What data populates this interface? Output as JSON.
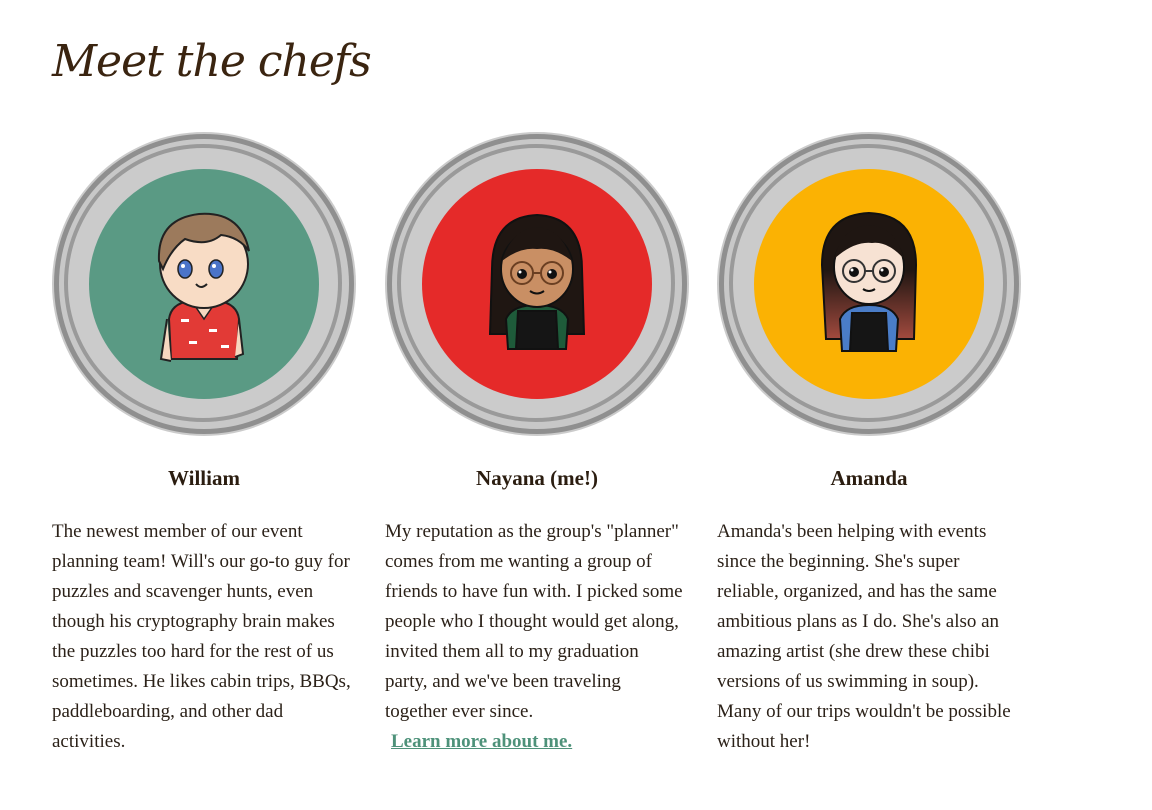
{
  "page": {
    "title": "Meet the chefs"
  },
  "chefs": [
    {
      "name": "William",
      "bio": "The newest member of our event planning team! Will's our go-to guy for puzzles and scavenger hunts, even though his cryptography brain makes the puzzles too hard for the rest of us sometimes. He likes cabin trips, BBQs, paddleboarding, and other dad activities.",
      "soup_color": "#5a9a84",
      "avatar_icon": "chibi-william-icon"
    },
    {
      "name": "Nayana (me!)",
      "bio": "My reputation as the group's \"planner\" comes from me wanting a group of friends to have fun with. I picked some people who I thought would get along, invited them all to my graduation party, and we've been traveling together ever since.",
      "link_label": "Learn more about me.",
      "soup_color": "#e52a29",
      "avatar_icon": "chibi-nayana-icon"
    },
    {
      "name": "Amanda",
      "bio": "Amanda's been helping with events since the beginning. She's super reliable, organized, and has the same ambitious plans as I do. She's also an amazing artist (she drew these chibi versions of us swimming in soup). Many of our trips wouldn't be possible without her!",
      "soup_color": "#fbb203",
      "avatar_icon": "chibi-amanda-icon"
    }
  ],
  "colors": {
    "bowl_outer": "#cbcbcb",
    "bowl_ring": "#8f8f8f",
    "link": "#4e927a",
    "title": "#3a2410"
  }
}
